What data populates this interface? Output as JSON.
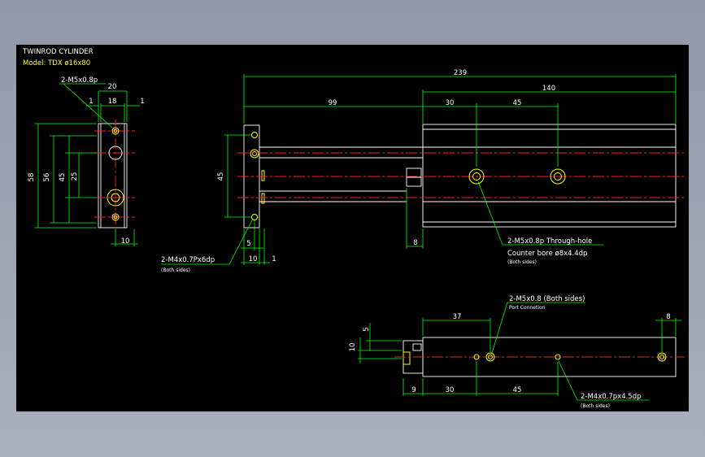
{
  "header": {
    "title": "TWINROD CYLINDER",
    "model": "Model: TDX ø16x80"
  },
  "end_view": {
    "callout": "2-M5x0.8p",
    "dims": {
      "width_total": "20",
      "width_inner": "18",
      "left_margin": "1",
      "right_margin": "1",
      "height_58": "58",
      "height_56": "56",
      "height_45": "45",
      "height_25": "25",
      "bottom_10": "10"
    }
  },
  "side_view": {
    "dims": {
      "overall": "239",
      "rod_len": "99",
      "body_len": "140",
      "d30": "30",
      "d45": "45",
      "plate_45": "45",
      "d5": "5",
      "d10": "10",
      "d1": "1",
      "d8": "8"
    },
    "callout_left": "2-M4x0.7Px6dp",
    "callout_left_sub": "(Both sides)",
    "callout_right": "2-M5x0.8p Through-hole",
    "callout_right_2": "Counter bore ø8x4.4dp",
    "callout_right_sub": "(Both sides)"
  },
  "bottom_view": {
    "dims": {
      "d37": "37",
      "d8": "8",
      "d5": "5",
      "d10": "10",
      "d9": "9",
      "d30": "30",
      "d45": "45"
    },
    "callout_port": "2-M5x0.8 (Both sides)",
    "callout_port_2": "Port Connetion",
    "callout_bottom": "2-M4x0.7px4.5dp",
    "callout_bottom_sub": "(Both sides)"
  },
  "colors": {
    "background": "#000000",
    "dimension": "#00ff00",
    "outline": "#ffffff",
    "centerline": "#ff2020",
    "hole": "#ffff00"
  }
}
